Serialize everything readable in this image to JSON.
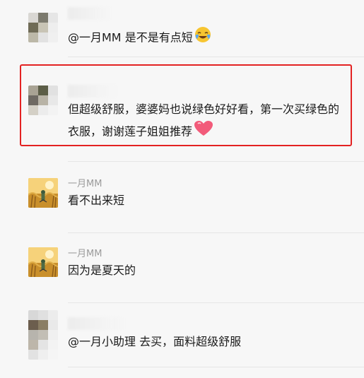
{
  "messages": [
    {
      "author": "",
      "text": "@一月MM 是不是有点短",
      "emoji": "laughing-crying-emoji"
    },
    {
      "author": "",
      "text": "但超级舒服，婆婆妈也说绿色好好看，第一次买绿色的衣服，谢谢莲子姐姐推荐",
      "emoji": "heart-emoji",
      "highlighted": true
    },
    {
      "author": "一月MM",
      "text": "看不出来短"
    },
    {
      "author": "一月MM",
      "text": "因为是夏天的"
    },
    {
      "author": "",
      "text": "@一月小助理 去买，面料超级舒服"
    }
  ],
  "colors": {
    "highlight_border": "#e32222",
    "background": "#f7f7f7",
    "nickname": "#9b9b9b"
  }
}
